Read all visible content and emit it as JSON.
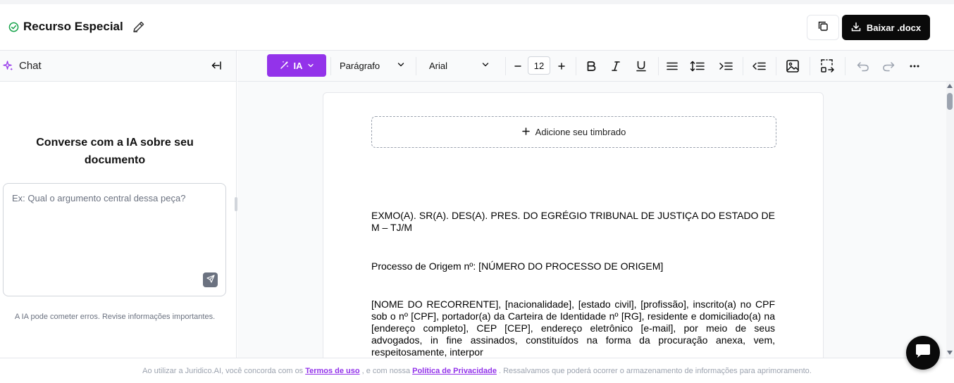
{
  "header": {
    "doc_title": "Recurso Especial",
    "download_label": "Baixar .docx"
  },
  "chat": {
    "title": "Chat",
    "heading_line1": "Converse com a IA sobre seu",
    "heading_line2": "documento",
    "input_placeholder": "Ex: Qual o argumento central dessa peça?",
    "disclaimer": "A IA pode cometer erros. Revise informações importantes."
  },
  "toolbar": {
    "ia_label": "IA",
    "paragraph_style": "Parágrafo",
    "font_family": "Arial",
    "font_size": "12"
  },
  "document": {
    "letterhead_label": "Adicione seu timbrado",
    "paragraphs": [
      "EXMO(A). SR(A). DES(A). PRES. DO EGRÉGIO TRIBUNAL DE JUSTIÇA DO ESTADO DE M – TJ/M",
      "Processo de Origem nº: [NÚMERO DO PROCESSO DE ORIGEM]",
      "[NOME DO RECORRENTE], [nacionalidade], [estado civil], [profissão], inscrito(a) no CPF sob o nº [CPF], portador(a) da Carteira de Identidade nº [RG], residente e domiciliado(a) na [endereço completo], CEP [CEP], endereço eletrônico [e-mail], por meio de seus advogados, in fine assinados, constituídos na forma da procuração anexa, vem, respeitosamente, interpor"
    ]
  },
  "footer": {
    "text_before": "Ao utilizar a Juridico.AI, você concorda com os",
    "terms_link": "Termos de uso",
    "text_middle": ", e com nossa",
    "privacy_link": "Política de Privacidade",
    "text_after": ". Ressalvamos que poderá ocorrer o armazenamento de informações para aprimoramento."
  },
  "colors": {
    "accent": "#9333ea",
    "primary_button": "#0a0a0a",
    "success": "#16a34a"
  }
}
